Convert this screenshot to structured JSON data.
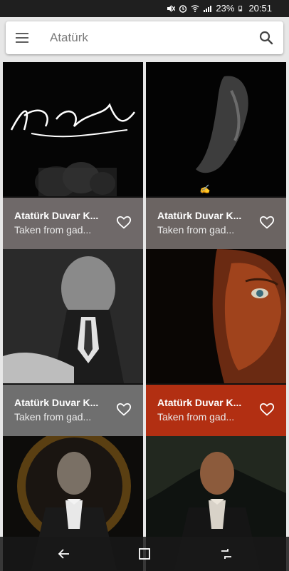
{
  "status_bar": {
    "battery": "23%",
    "time": "20:51"
  },
  "search": {
    "query": "Atatürk"
  },
  "cards": [
    {
      "title": "Atatürk Duvar K...",
      "subtitle": "Taken from gad...",
      "caption_color": "#6f6969",
      "image": "signature-portrait"
    },
    {
      "title": "Atatürk Duvar K...",
      "subtitle": "Taken from gad...",
      "caption_color": "#6b6462",
      "image": "profile-portrait"
    },
    {
      "title": "Atatürk Duvar K...",
      "subtitle": "Taken from gad...",
      "caption_color": "#6f6f6f",
      "image": "bw-portrait"
    },
    {
      "title": "Atatürk Duvar K...",
      "subtitle": "Taken from gad...",
      "caption_color": "#b22f12",
      "image": "red-portrait"
    },
    {
      "title": "",
      "subtitle": "",
      "caption_color": "#222222",
      "image": "full-portrait-1"
    },
    {
      "title": "",
      "subtitle": "",
      "caption_color": "#222222",
      "image": "full-portrait-2"
    }
  ]
}
